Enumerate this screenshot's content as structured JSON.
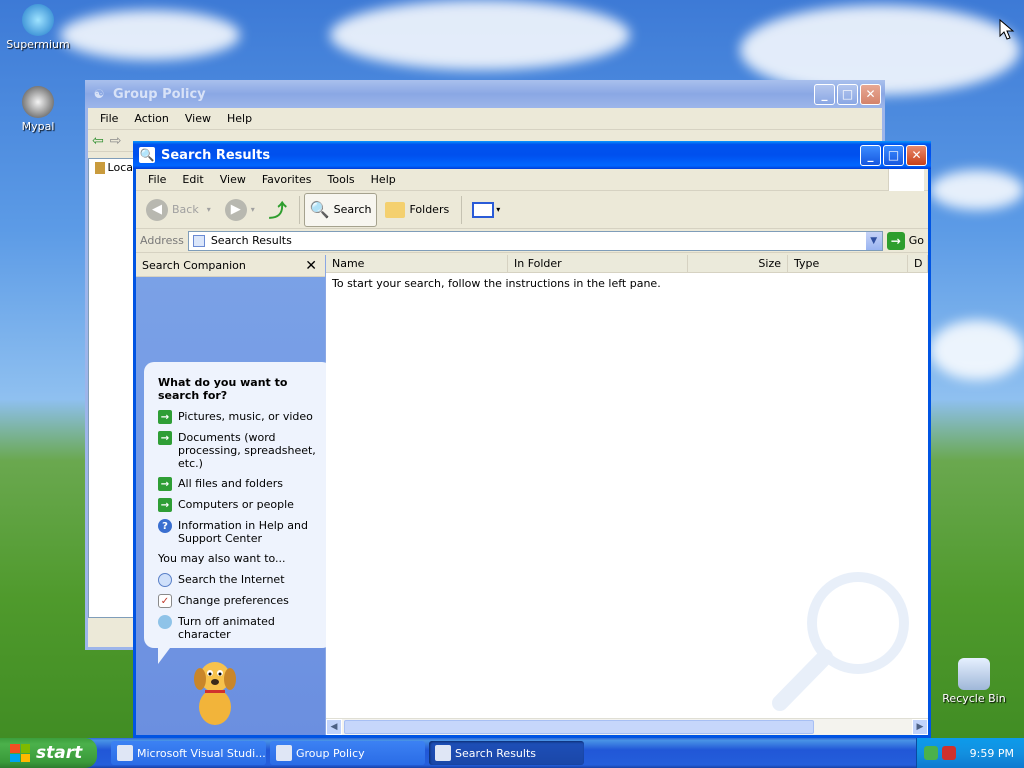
{
  "desktop": {
    "icons": [
      {
        "label": "Supermium"
      },
      {
        "label": "Mypal"
      },
      {
        "label": "Recycle Bin"
      }
    ]
  },
  "group_policy": {
    "title": "Group Policy",
    "menu": [
      "File",
      "Action",
      "View",
      "Help"
    ],
    "tree_label": "Loca"
  },
  "search_results": {
    "title": "Search Results",
    "menu": [
      "File",
      "Edit",
      "View",
      "Favorites",
      "Tools",
      "Help"
    ],
    "toolbar": {
      "back": "Back",
      "search": "Search",
      "folders": "Folders"
    },
    "address": {
      "label": "Address",
      "value": "Search Results",
      "go": "Go"
    },
    "companion": {
      "title": "Search Companion",
      "close": "✕",
      "heading": "What do you want to search for?",
      "options": [
        "Pictures, music, or video",
        "Documents (word processing, spreadsheet, etc.)",
        "All files and folders",
        "Computers or people",
        "Information in Help and Support Center"
      ],
      "also_heading": "You may also want to...",
      "also": [
        "Search the Internet",
        "Change preferences",
        "Turn off animated character"
      ]
    },
    "columns": [
      "Name",
      "In Folder",
      "Size",
      "Type",
      "D"
    ],
    "message": "To start your search, follow the instructions in the left pane."
  },
  "taskbar": {
    "start": "start",
    "tasks": [
      {
        "label": "Microsoft Visual Studi..."
      },
      {
        "label": "Group Policy"
      },
      {
        "label": "Search Results"
      }
    ],
    "clock": "9:59 PM"
  },
  "colors": {
    "titlebar": "#0054e3",
    "start": "#3c9e3c",
    "taskbar": "#245edb"
  }
}
